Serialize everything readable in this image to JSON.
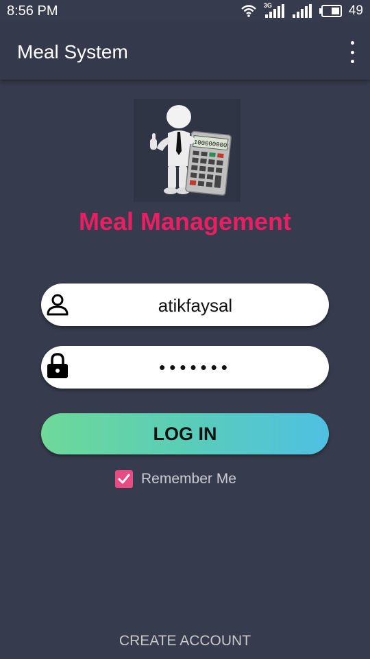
{
  "status_bar": {
    "time": "8:56 PM",
    "network_label": "3G",
    "battery_level": "49"
  },
  "app_bar": {
    "title": "Meal System",
    "menu_icon": "more-vert-icon"
  },
  "logo": {
    "calculator_display": "100000000"
  },
  "brand": {
    "title": "Meal Management",
    "color": "#e91e63"
  },
  "login_form": {
    "username_icon": "person-icon",
    "username_value": "atikfaysal",
    "password_icon": "lock-icon",
    "password_value": "•••••••",
    "login_label": "LOG IN",
    "remember_label": "Remember Me",
    "remember_checked": true
  },
  "footer": {
    "create_account_label": "CREATE ACCOUNT"
  },
  "colors": {
    "background": "#363c4d",
    "accent": "#e84b82",
    "gradient_start": "#6ed998",
    "gradient_end": "#4fc0e2"
  }
}
